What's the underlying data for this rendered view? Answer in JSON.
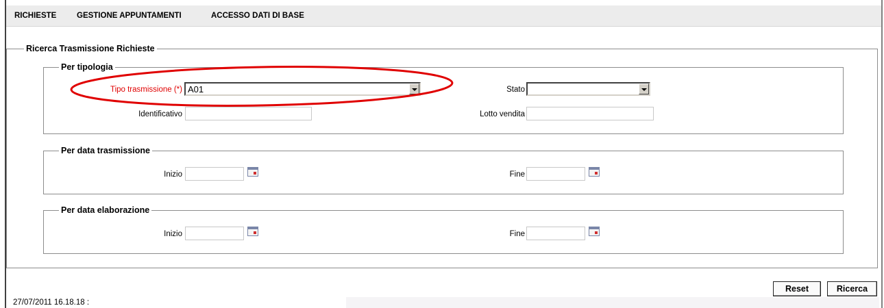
{
  "menu": {
    "items": [
      {
        "label": "RICHIESTE"
      },
      {
        "label": "GESTIONE APPUNTAMENTI"
      },
      {
        "label": "ACCESSO DATI DI BASE"
      }
    ]
  },
  "search": {
    "title": "Ricerca Trasmissione Richieste",
    "per_tipologia": {
      "legend": "Per tipologia",
      "tipo_label": "Tipo trasmissione (*)",
      "tipo_value": "A01",
      "stato_label": "Stato",
      "stato_value": "",
      "identificativo_label": "Identificativo",
      "identificativo_value": "",
      "lotto_label": "Lotto vendita",
      "lotto_value": ""
    },
    "per_data_trasmissione": {
      "legend": "Per data trasmissione",
      "inizio_label": "Inizio",
      "inizio_value": "",
      "fine_label": "Fine",
      "fine_value": ""
    },
    "per_data_elaborazione": {
      "legend": "Per data elaborazione",
      "inizio_label": "Inizio",
      "inizio_value": "",
      "fine_label": "Fine",
      "fine_value": ""
    }
  },
  "buttons": {
    "reset": "Reset",
    "ricerca": "Ricerca"
  },
  "status": {
    "timestamp": "27/07/2011 16.18.18  :"
  },
  "icons": {
    "calendar": "calendar-icon",
    "dropdown": "chevron-down-icon"
  },
  "colors": {
    "required_label": "#e00000",
    "annotation": "#e00000"
  }
}
